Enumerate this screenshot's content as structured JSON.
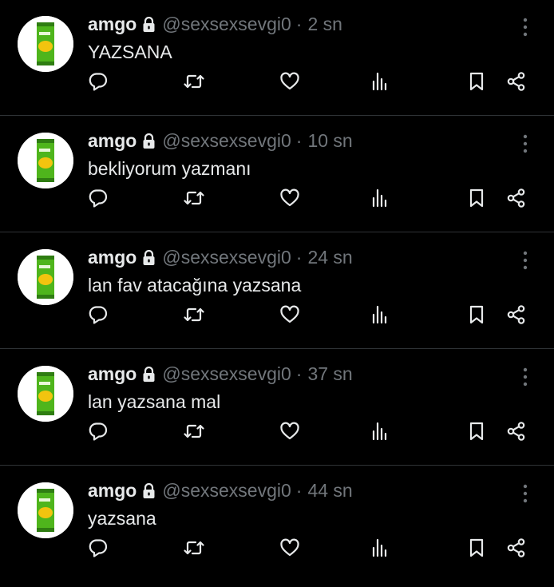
{
  "user": {
    "display_name": "amgo",
    "handle": "@sexsexsevgi0",
    "separator": "·"
  },
  "tweets": [
    {
      "time": "2 sn",
      "text": "YAZSANA"
    },
    {
      "time": "10 sn",
      "text": "bekliyorum yazmanı"
    },
    {
      "time": "24 sn",
      "text": "lan fav atacağına yazsana"
    },
    {
      "time": "37 sn",
      "text": "lan yazsana mal"
    },
    {
      "time": "44 sn",
      "text": "yazsana"
    }
  ],
  "icons": {
    "reply": "reply-icon",
    "retweet": "retweet-icon",
    "like": "like-icon",
    "views": "views-icon",
    "bookmark": "bookmark-icon",
    "share": "share-icon",
    "lock": "lock-icon",
    "more": "more-icon"
  },
  "colors": {
    "background": "#000000",
    "text": "#e7e9ea",
    "muted": "#71767b",
    "divider": "#2f3336",
    "avatar_can": "#5cc421"
  }
}
